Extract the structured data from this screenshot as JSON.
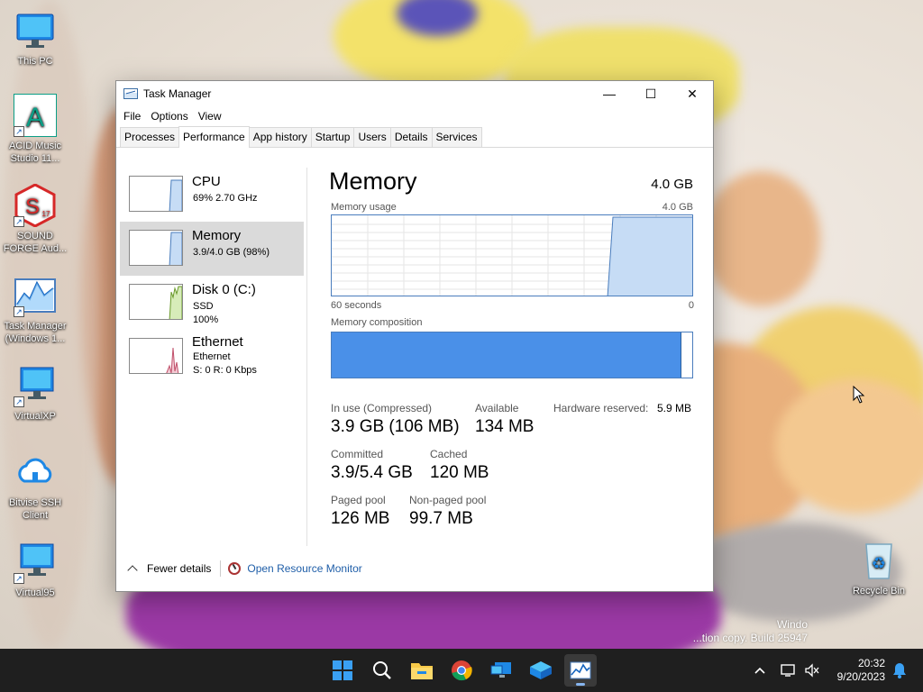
{
  "desktop": {
    "icons": [
      {
        "label": "This PC"
      },
      {
        "label": "ACID Music Studio 11...",
        "glyph": "A"
      },
      {
        "label": "SOUND FORGE Aud...",
        "glyph": "S",
        "badge": "17"
      },
      {
        "label": "Task Manager (Windows 1..."
      },
      {
        "label": "VirtualXP"
      },
      {
        "label": "Bitvise SSH Client"
      },
      {
        "label": "Virtual95"
      },
      {
        "label": "Recycle Bin"
      }
    ],
    "watermark_line1": "Windo",
    "watermark_line2": "...tion copy. Build 25947"
  },
  "window": {
    "title": "Task Manager",
    "controls": {
      "minimize": "—",
      "maximize": "☐",
      "close": "✕"
    },
    "menu": [
      "File",
      "Options",
      "View"
    ],
    "tabs": [
      "Processes",
      "Performance",
      "App history",
      "Startup",
      "Users",
      "Details",
      "Services"
    ],
    "active_tab": "Performance"
  },
  "sidebar": {
    "items": [
      {
        "name": "CPU",
        "sub1": "69% 2.70 GHz",
        "sub2": ""
      },
      {
        "name": "Memory",
        "sub1": "3.9/4.0 GB (98%)",
        "sub2": ""
      },
      {
        "name": "Disk 0 (C:)",
        "sub1": "SSD",
        "sub2": "100%"
      },
      {
        "name": "Ethernet",
        "sub1": "Ethernet",
        "sub2": "S: 0 R: 0 Kbps"
      }
    ],
    "selected": "Memory"
  },
  "memory": {
    "title": "Memory",
    "total": "4.0 GB",
    "usage_label": "Memory usage",
    "usage_max": "4.0 GB",
    "time_left": "60 seconds",
    "time_right": "0",
    "composition_label": "Memory composition",
    "composition_in_use_fraction": 0.97,
    "stats": {
      "in_use_label": "In use (Compressed)",
      "in_use": "3.9 GB (106 MB)",
      "available_label": "Available",
      "available": "134 MB",
      "hw_reserved_label": "Hardware reserved:",
      "hw_reserved": "5.9 MB",
      "committed_label": "Committed",
      "committed": "3.9/5.4 GB",
      "cached_label": "Cached",
      "cached": "120 MB",
      "paged_label": "Paged pool",
      "paged": "126 MB",
      "nonpaged_label": "Non-paged pool",
      "nonpaged": "99.7 MB"
    }
  },
  "footer": {
    "fewer_details": "Fewer details",
    "open_resource_monitor": "Open Resource Monitor"
  },
  "taskbar": {
    "time": "20:32",
    "date": "9/20/2023"
  },
  "colors": {
    "memory_blue": "#4a90e8",
    "graph_fill": "#c6dcf5",
    "disk_green": "#8bc34a",
    "ethernet_red": "#c0506a",
    "taskbar": "#1f1f1f"
  }
}
